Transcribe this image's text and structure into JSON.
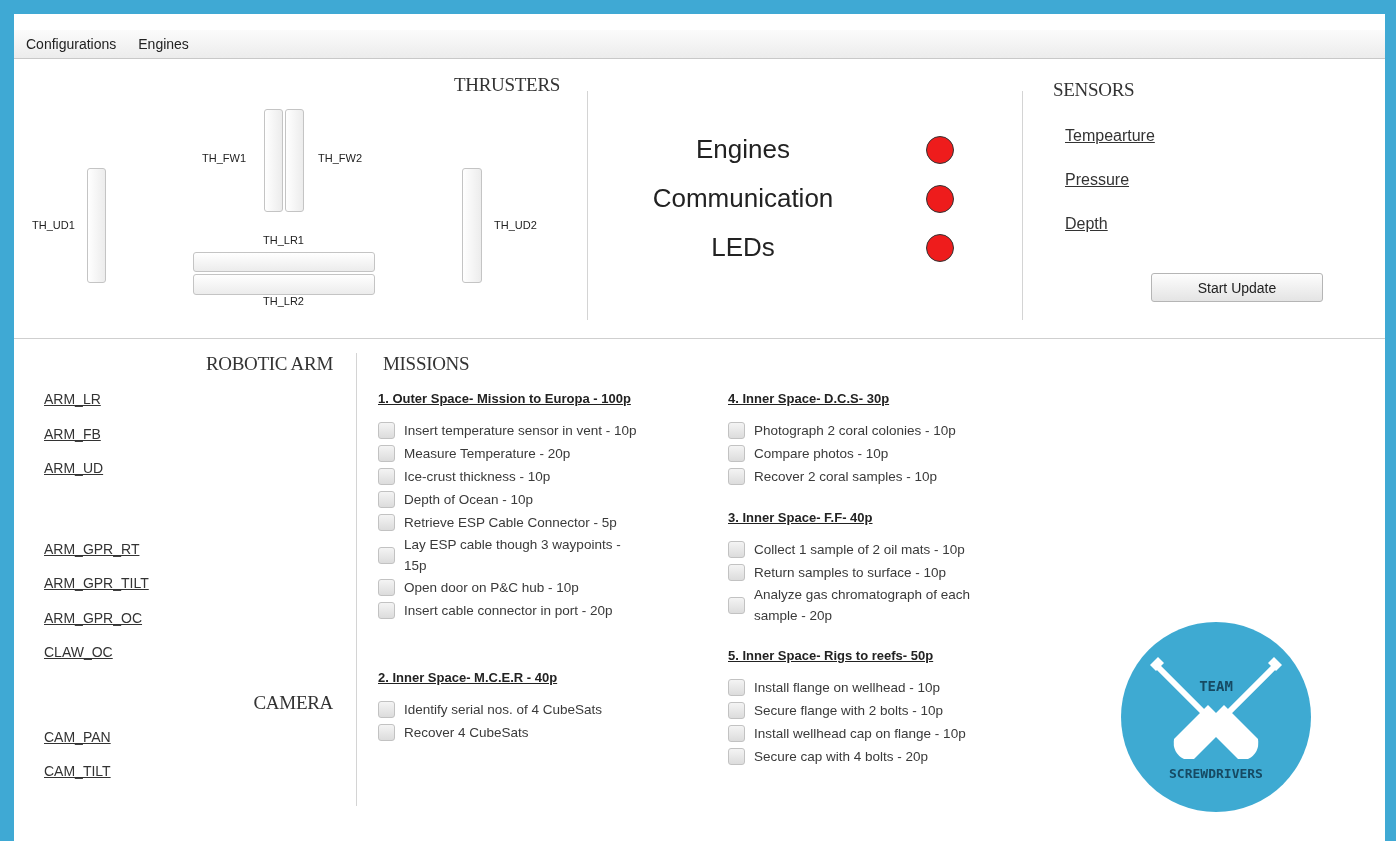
{
  "menu": [
    {
      "label": "Configurations"
    },
    {
      "label": "Engines"
    }
  ],
  "thrusters": {
    "title": "THRUSTERS",
    "items": [
      {
        "label": "TH_UD1",
        "kind": "vertical"
      },
      {
        "label": "TH_FW1",
        "kind": "vertical"
      },
      {
        "label": "TH_FW2",
        "kind": "vertical"
      },
      {
        "label": "TH_LR1",
        "kind": "horizontal"
      },
      {
        "label": "TH_LR2",
        "kind": "horizontal"
      },
      {
        "label": "TH_UD2",
        "kind": "vertical"
      }
    ]
  },
  "status": [
    {
      "label": "Engines",
      "on": false
    },
    {
      "label": "Communication",
      "on": false
    },
    {
      "label": "LEDs",
      "on": false
    }
  ],
  "sensors": {
    "title": "SENSORS",
    "links": [
      "Tempearture",
      "Pressure",
      "Depth"
    ],
    "button": "Start Update"
  },
  "robotic_arm": {
    "title": "ROBOTIC ARM",
    "groups": [
      [
        "ARM_LR",
        "ARM_FB",
        "ARM_UD"
      ],
      [
        "ARM_GPR_RT",
        "ARM_GPR_TILT",
        "ARM_GPR_OC",
        "CLAW_OC"
      ]
    ]
  },
  "camera": {
    "title": "CAMERA",
    "links": [
      "CAM_PAN",
      "CAM_TILT"
    ]
  },
  "missions": {
    "title": "MISSIONS",
    "columns": [
      {
        "groups": [
          {
            "title": "1. Outer Space- Mission to Europa - 100p",
            "tasks": [
              {
                "label": "Insert temperature sensor in vent - 10p",
                "checked": false
              },
              {
                "label": "Measure Temperature - 20p",
                "checked": false
              },
              {
                "label": "Ice-crust thickness - 10p",
                "checked": false
              },
              {
                "label": "Depth of Ocean - 10p",
                "checked": false
              },
              {
                "label": "Retrieve ESP Cable Connector - 5p",
                "checked": false
              },
              {
                "label": "Lay ESP cable though 3 waypoints - 15p",
                "checked": false
              },
              {
                "label": "Open door on P&C hub - 10p",
                "checked": false
              },
              {
                "label": "Insert cable connector in port - 20p",
                "checked": false
              }
            ]
          },
          {
            "title": "2. Inner Space- M.C.E.R - 40p",
            "tasks": [
              {
                "label": "Identify serial nos. of 4 CubeSats",
                "checked": false
              },
              {
                "label": "Recover 4 CubeSats",
                "checked": false
              }
            ]
          }
        ]
      },
      {
        "groups": [
          {
            "title": "4. Inner Space- D.C.S- 30p",
            "tasks": [
              {
                "label": "Photograph 2 coral colonies - 10p",
                "checked": false
              },
              {
                "label": "Compare photos - 10p",
                "checked": false
              },
              {
                "label": "Recover 2 coral samples - 10p",
                "checked": false
              }
            ]
          },
          {
            "title": "3. Inner Space- F.F- 40p",
            "tasks": [
              {
                "label": "Collect 1 sample of 2 oil mats - 10p",
                "checked": false
              },
              {
                "label": "Return samples to surface - 10p",
                "checked": false
              },
              {
                "label": "Analyze gas chromatograph of each sample - 20p",
                "checked": false
              }
            ]
          },
          {
            "title": "5. Inner Space- Rigs to reefs- 50p",
            "tasks": [
              {
                "label": "Install flange on wellhead - 10p",
                "checked": false
              },
              {
                "label": "Secure flange with 2 bolts - 10p",
                "checked": false
              },
              {
                "label": "Install wellhead cap on flange - 10p",
                "checked": false
              },
              {
                "label": "Secure cap with 4 bolts - 20p",
                "checked": false
              }
            ]
          }
        ]
      }
    ]
  },
  "logo": {
    "top": "TEAM",
    "bottom": "SCREWDRIVERS"
  }
}
